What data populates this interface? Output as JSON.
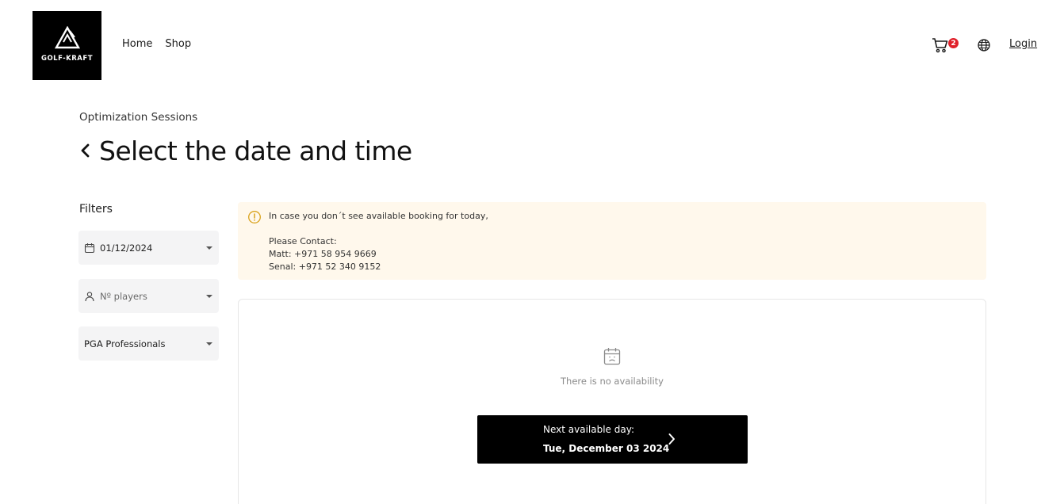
{
  "brand": {
    "name": "GOLF-KRAFT"
  },
  "nav": {
    "items": [
      "Home",
      "Shop"
    ]
  },
  "header": {
    "cart_count": "2",
    "login_label": "Login"
  },
  "page": {
    "breadcrumb": "Optimization Sessions",
    "title": "Select the date and time"
  },
  "filters": {
    "title": "Filters",
    "date_value": "01/12/2024",
    "players_placeholder": "Nº players",
    "professional_value": "PGA Professionals"
  },
  "notice": {
    "line1": "In case you don´t see available booking for today,",
    "line2": "",
    "line3": "Please Contact:",
    "line4": "Matt: +971 58 954 9669",
    "line5": "Senal: +971 52 340 9152"
  },
  "availability": {
    "empty_text": "There is no availability",
    "next_label": "Next available day:",
    "next_date": "Tue, December 03 2024"
  },
  "colors": {
    "badge": "#e0202a",
    "notice_bg": "#fff8ec",
    "warning": "#d9a21b",
    "button_bg": "#000000"
  },
  "icons": [
    "logo-mark-icon",
    "cart-icon",
    "globe-icon",
    "back-chevron-icon",
    "calendar-icon",
    "user-icon",
    "caret-down-icon",
    "warning-icon",
    "calendar-sad-icon",
    "chevron-right-icon"
  ]
}
